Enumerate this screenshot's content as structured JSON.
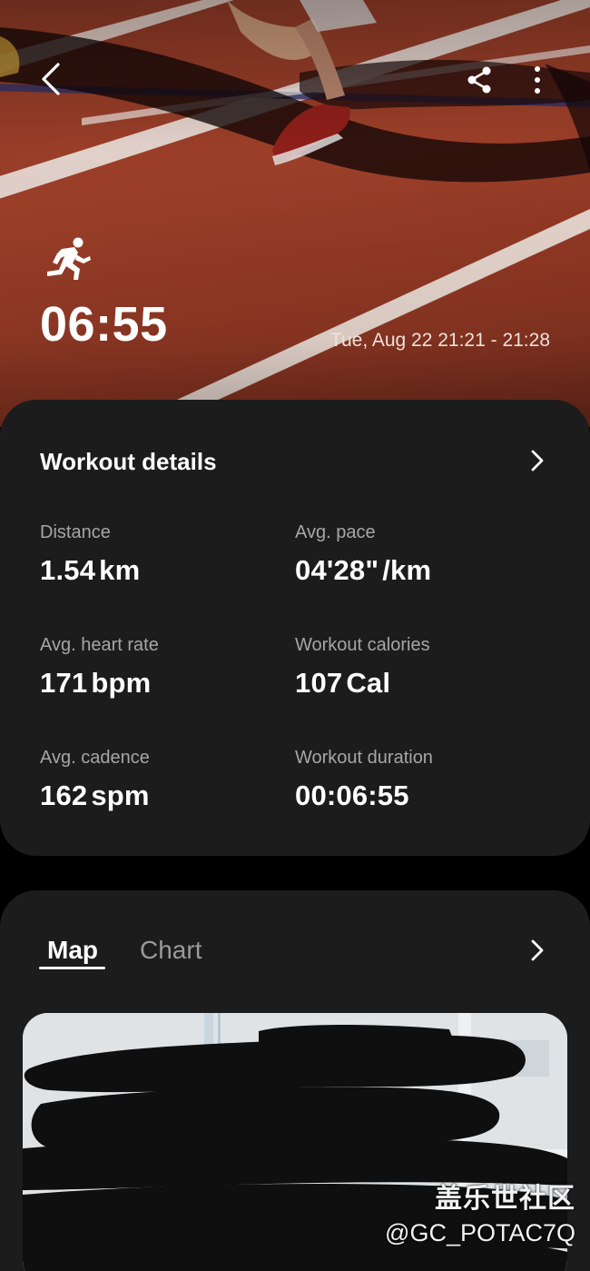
{
  "header": {
    "back_icon": "chevron-left-icon",
    "share_icon": "share-icon",
    "more_icon": "more-vertical-icon",
    "activity_icon": "running-icon",
    "duration": "06:55",
    "date_range": "Tue, Aug 22 21:21 - 21:28"
  },
  "details": {
    "title": "Workout details",
    "stats": [
      {
        "label": "Distance",
        "value": "1.54",
        "unit": "km"
      },
      {
        "label": "Avg. pace",
        "value": "04'28\"",
        "unit": "/km"
      },
      {
        "label": "Avg. heart rate",
        "value": "171",
        "unit": "bpm"
      },
      {
        "label": "Workout calories",
        "value": "107",
        "unit": "Cal"
      },
      {
        "label": "Avg. cadence",
        "value": "162",
        "unit": "spm"
      },
      {
        "label": "Workout duration",
        "value": "00:06:55",
        "unit": ""
      }
    ]
  },
  "map_section": {
    "tabs": [
      {
        "label": "Map",
        "selected": true
      },
      {
        "label": "Chart",
        "selected": false
      }
    ]
  },
  "watermark": {
    "line1": "盖乐世社区",
    "line2": "@GC_POTAC7Q"
  },
  "colors": {
    "card_bg": "#1c1c1c",
    "track_red": "#9c3f29",
    "label_gray": "#a6a6a6"
  }
}
